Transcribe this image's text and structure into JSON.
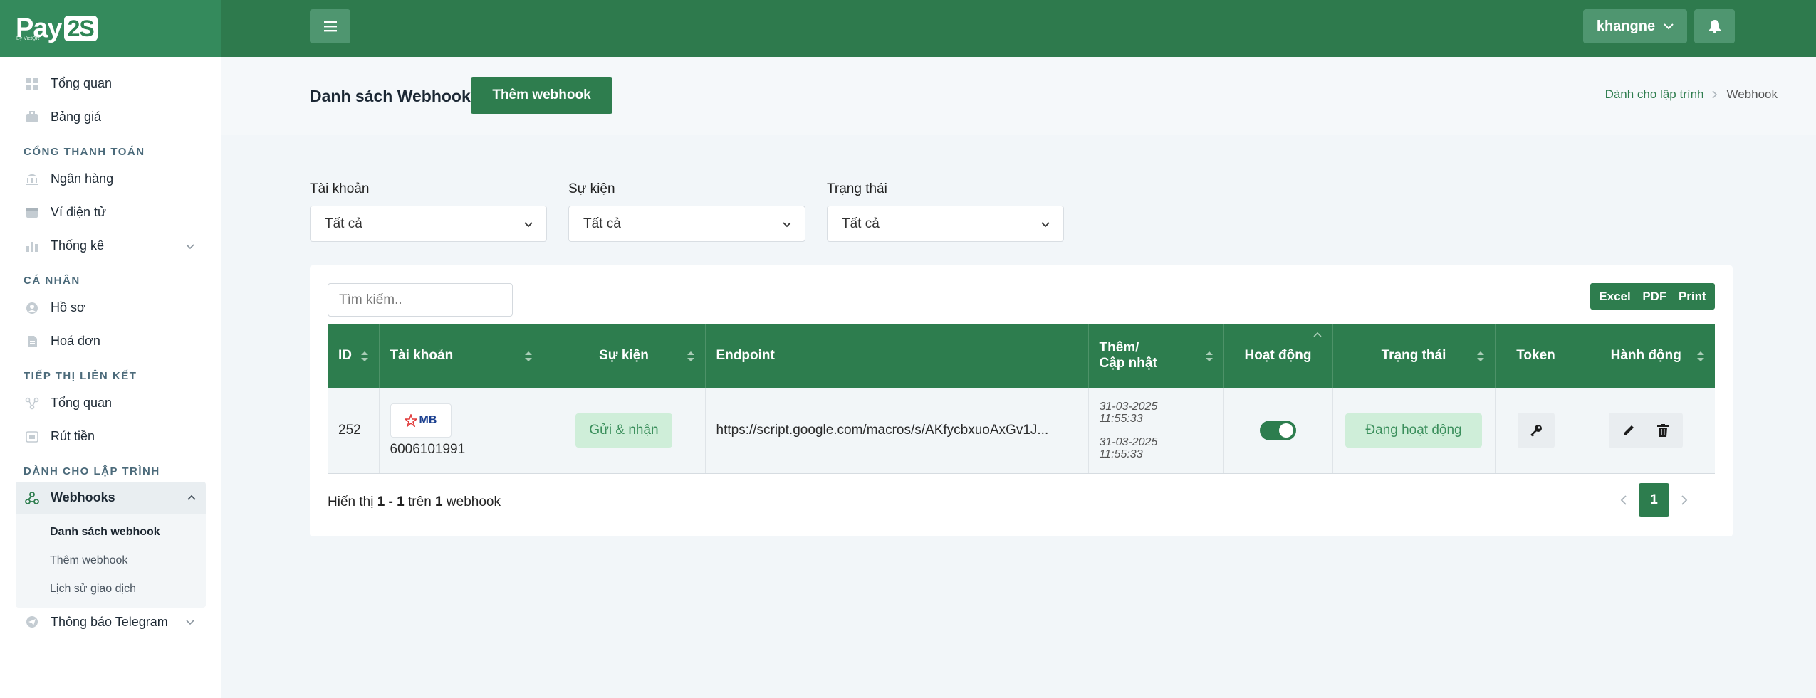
{
  "brand": {
    "logo_main": "Pay",
    "logo_box": "2S",
    "logo_sub": "By VietQR"
  },
  "sidebar": {
    "top_items": [
      {
        "label": "Tổng quan",
        "icon": "grid-icon"
      },
      {
        "label": "Bảng giá",
        "icon": "briefcase-icon"
      }
    ],
    "sections": [
      {
        "title": "CỔNG THANH TOÁN",
        "items": [
          {
            "label": "Ngân hàng",
            "icon": "bank-icon"
          },
          {
            "label": "Ví điện tử",
            "icon": "wallet-icon"
          },
          {
            "label": "Thống kê",
            "icon": "bar-chart-icon"
          }
        ]
      },
      {
        "title": "CÁ NHÂN",
        "items": [
          {
            "label": "Hồ sơ",
            "icon": "user-circle-icon"
          },
          {
            "label": "Hoá đơn",
            "icon": "invoice-icon"
          }
        ]
      },
      {
        "title": "TIẾP THỊ LIÊN KẾT",
        "items": [
          {
            "label": "Tổng quan",
            "icon": "network-icon"
          },
          {
            "label": "Rút tiền",
            "icon": "withdraw-icon"
          }
        ]
      },
      {
        "title": "DÀNH CHO LẬP TRÌNH",
        "items": [
          {
            "label": "Webhooks",
            "icon": "webhook-icon"
          }
        ]
      }
    ],
    "submenu": [
      "Danh sách webhook",
      "Thêm webhook",
      "Lịch sử giao dịch"
    ],
    "last_item": "Thông báo Telegram"
  },
  "topbar": {
    "username": "khangne"
  },
  "header": {
    "title": "Danh sách Webhook",
    "add_button": "Thêm webhook",
    "breadcrumb": [
      "Dành cho lập trình",
      "Webhook"
    ]
  },
  "filters": [
    {
      "label": "Tài khoản",
      "value": "Tất cả"
    },
    {
      "label": "Sự kiện",
      "value": "Tất cả"
    },
    {
      "label": "Trạng thái",
      "value": "Tất cả"
    }
  ],
  "search": {
    "placeholder": "Tìm kiếm.."
  },
  "exports": [
    "Excel",
    "PDF",
    "Print"
  ],
  "table": {
    "columns": [
      "ID",
      "Tài khoản",
      "Sự kiện",
      "Endpoint",
      "Thêm/",
      "Cập nhật",
      "Hoạt động",
      "Trạng thái",
      "Token",
      "Hành động"
    ],
    "rows": [
      {
        "id": "252",
        "bank": "MB",
        "account": "6006101991",
        "event": "Gửi & nhận",
        "endpoint": "https://script.google.com/macros/s/AKfycbxuoAxGv1J...",
        "created_date": "31-03-2025",
        "created_time": "11:55:33",
        "updated_date": "31-03-2025",
        "updated_time": "11:55:33",
        "active": true,
        "status": "Đang hoạt động"
      }
    ]
  },
  "summary": {
    "prefix": "Hiển thị",
    "range": "1 - 1",
    "mid": "trên",
    "total": "1",
    "suffix": "webhook"
  },
  "pagination": {
    "current": "1"
  },
  "colors": {
    "primary": "#2e7d4e",
    "badge_bg": "#cfeed9",
    "badge_text": "#3b8f5c"
  }
}
